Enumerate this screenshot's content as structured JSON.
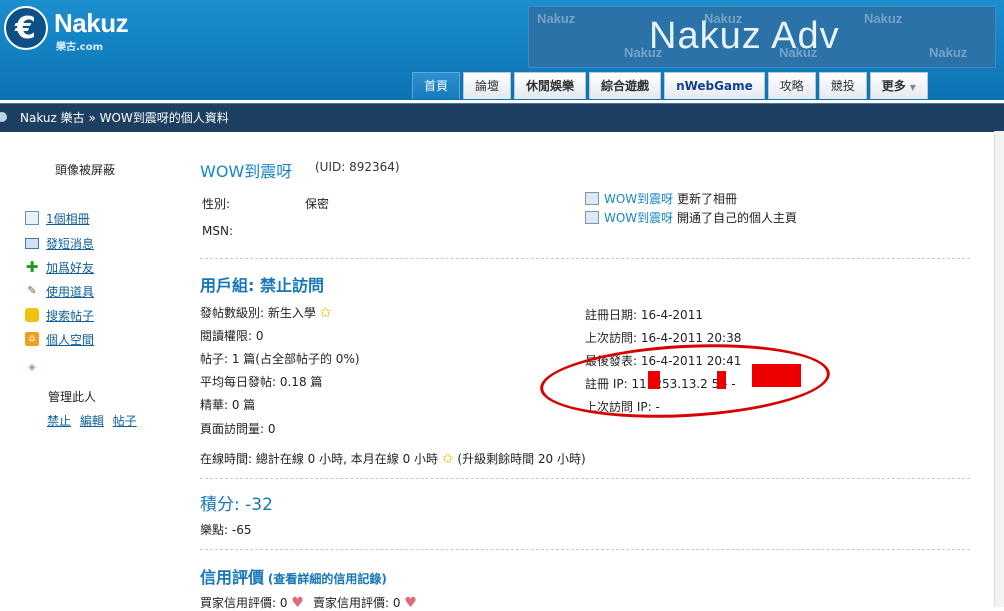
{
  "header": {
    "logo_text": "Nakuz",
    "logo_sub": "樂古.com",
    "adv_text": "Nakuz Adv",
    "adv_watermark": "Nakuz"
  },
  "nav": {
    "items": [
      "首頁",
      "論壇",
      "休閒娛樂",
      "綜合遊戲",
      "nWebGame",
      "攻略",
      "競投",
      "更多"
    ]
  },
  "breadcrumb": {
    "text": "Nakuz 樂古 » WOW到震呀的個人資料"
  },
  "sidebar": {
    "avatar_hidden": "頭像被屏蔽",
    "items": [
      "1個相冊",
      "發短消息",
      "加爲好友",
      "使用道具",
      "搜索帖子",
      "個人空間"
    ],
    "manage_title": "管理此人",
    "manage_links": [
      "禁止",
      "編輯",
      "帖子"
    ]
  },
  "profile": {
    "username": "WOW到震呀",
    "uid": "(UID: 892364)",
    "gender_label": "性別:",
    "gender_value": "保密",
    "msn_label": "MSN:",
    "feed": [
      {
        "name": "WOW到震呀",
        "action": "更新了相冊"
      },
      {
        "name": "WOW到震呀",
        "action": "開通了自己的個人主頁"
      }
    ]
  },
  "group": {
    "title": "用戶組: 禁止訪問",
    "stats_left": [
      "發帖數級別: 新生入學",
      "閱讀權限: 0",
      "帖子: 1 篇(占全部帖子的 0%)",
      "平均每日發帖: 0.18 篇",
      "精華: 0 篇",
      "頁面訪問量: 0"
    ],
    "stats_right": [
      "註冊日期: 16-4-2011",
      "上次訪問: 16-4-2011 20:38",
      "最後發表: 16-4-2011 20:41",
      "註冊 IP: 11  .253.13.2  5 - -",
      "上次訪問 IP: -"
    ],
    "online_time": "在線時間: 總計在線 0 小時, 本月在線 0 小時",
    "online_upgrade": "(升級剩餘時間 20 小時)"
  },
  "points": {
    "title": "積分: -32",
    "coins": "樂點: -65"
  },
  "credit": {
    "title": "信用評價",
    "detail_link": "(查看詳細的信用記錄)",
    "buyer": "買家信用評價: 0",
    "seller": "賣家信用評價: 0"
  },
  "colors": {
    "accent": "#1686c6",
    "header": "#0c73b3",
    "annotation": "#d80000"
  }
}
